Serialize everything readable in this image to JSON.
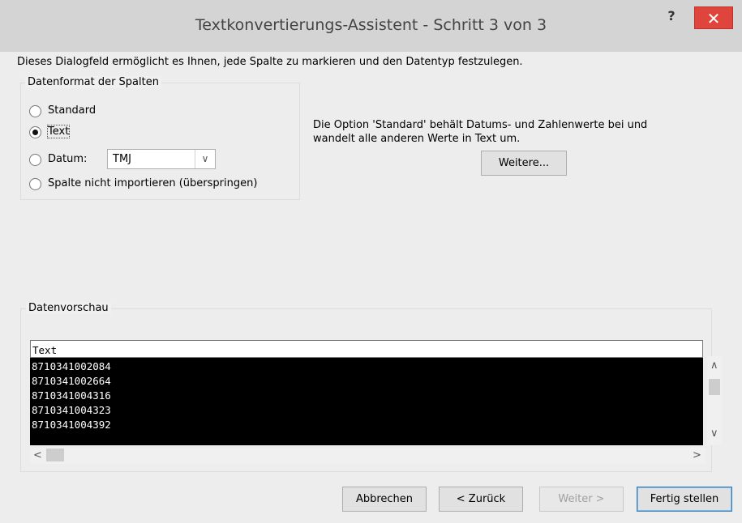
{
  "window": {
    "title": "Textkonvertierungs-Assistent - Schritt 3 von 3",
    "help_glyph": "?",
    "close_glyph": "✕"
  },
  "intro_text": "Dieses Dialogfeld ermöglicht es Ihnen, jede Spalte zu markieren und den Datentyp festzulegen.",
  "column_format": {
    "legend": "Datenformat der Spalten",
    "options": [
      {
        "label": "Standard",
        "checked": false
      },
      {
        "label": "Text",
        "checked": true
      },
      {
        "label": "Datum:",
        "checked": false
      },
      {
        "label": "Spalte nicht importieren (überspringen)",
        "checked": false
      }
    ],
    "date_format_value": "TMJ"
  },
  "description": {
    "line1": "Die Option 'Standard' behält Datums- und Zahlenwerte bei und",
    "line2": "wandelt alle anderen Werte in Text um.",
    "more_button": "Weitere..."
  },
  "preview": {
    "legend": "Datenvorschau",
    "header": "Text",
    "rows": [
      "8710341002084",
      "8710341002664",
      "8710341004316",
      "8710341004323",
      "8710341004392"
    ]
  },
  "buttons": {
    "cancel": "Abbrechen",
    "back": "< Zurück",
    "next": "Weiter >",
    "finish": "Fertig stellen"
  }
}
